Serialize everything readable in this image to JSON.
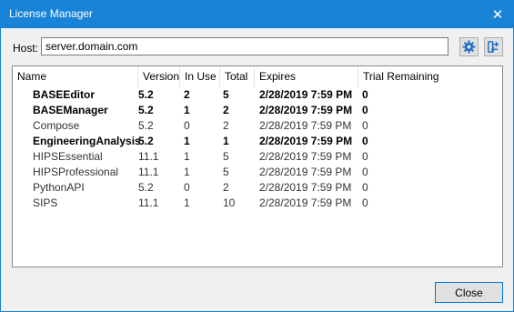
{
  "window": {
    "title": "License Manager",
    "close_glyph": "✕"
  },
  "host": {
    "label": "Host:",
    "value": "server.domain.com"
  },
  "toolbar": {
    "settings_icon": "gear-icon",
    "connect_icon": "swap-icon"
  },
  "table": {
    "columns": [
      "Name",
      "Version",
      "In Use",
      "Total",
      "Expires",
      "Trial Remaining"
    ],
    "rows": [
      {
        "name": "BASEEditor",
        "version": "5.2",
        "in_use": "2",
        "total": "5",
        "expires": "2/28/2019 7:59 PM",
        "trial": "0",
        "bold": true
      },
      {
        "name": "BASEManager",
        "version": "5.2",
        "in_use": "1",
        "total": "2",
        "expires": "2/28/2019 7:59 PM",
        "trial": "0",
        "bold": true
      },
      {
        "name": "Compose",
        "version": "5.2",
        "in_use": "0",
        "total": "2",
        "expires": "2/28/2019 7:59 PM",
        "trial": "0",
        "bold": false
      },
      {
        "name": "EngineeringAnalysis",
        "version": "5.2",
        "in_use": "1",
        "total": "1",
        "expires": "2/28/2019 7:59 PM",
        "trial": "0",
        "bold": true
      },
      {
        "name": "HIPSEssential",
        "version": "11.1",
        "in_use": "1",
        "total": "5",
        "expires": "2/28/2019 7:59 PM",
        "trial": "0",
        "bold": false
      },
      {
        "name": "HIPSProfessional",
        "version": "11.1",
        "in_use": "1",
        "total": "5",
        "expires": "2/28/2019 7:59 PM",
        "trial": "0",
        "bold": false
      },
      {
        "name": "PythonAPI",
        "version": "5.2",
        "in_use": "0",
        "total": "2",
        "expires": "2/28/2019 7:59 PM",
        "trial": "0",
        "bold": false
      },
      {
        "name": "SIPS",
        "version": "11.1",
        "in_use": "1",
        "total": "10",
        "expires": "2/28/2019 7:59 PM",
        "trial": "0",
        "bold": false
      }
    ]
  },
  "footer": {
    "close_label": "Close"
  }
}
